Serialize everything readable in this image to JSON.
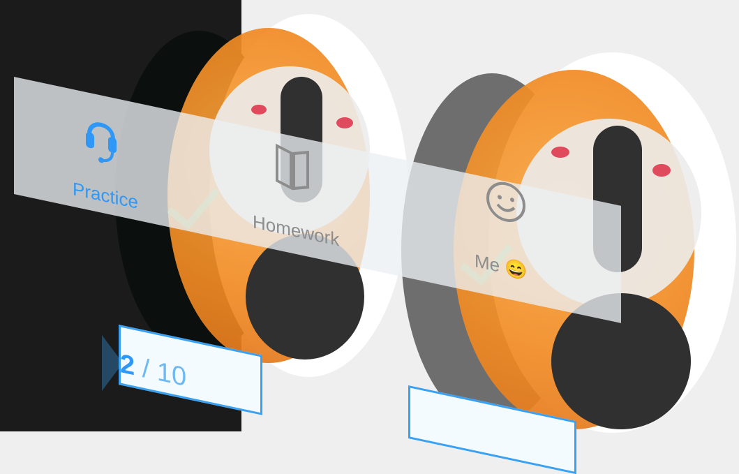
{
  "tabs": [
    {
      "label": "Practice",
      "icon": "headset-icon",
      "active": true
    },
    {
      "label": "Homework",
      "icon": "book-icon",
      "active": false
    },
    {
      "label": "Me 😄",
      "icon": "smiley-icon",
      "active": false
    }
  ],
  "progress_badge": {
    "current": "2",
    "separator": " / ",
    "total": "10"
  },
  "colors": {
    "accent": "#2f97f5",
    "orange": "#f18b24",
    "dark": "#1b1b1b",
    "light": "#efefef"
  }
}
